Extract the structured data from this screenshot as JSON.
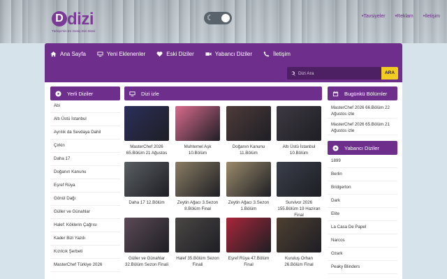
{
  "brand": {
    "logo_mark": "D",
    "logo_text": "dizi",
    "tagline": "Türkiye'nin En Geniş Dizi Sitesi"
  },
  "top_links": [
    "Tavsiyeler",
    "Reklam",
    "İletişim"
  ],
  "nav": [
    {
      "label": "Ana Sayfa",
      "icon": "home-icon"
    },
    {
      "label": "Yeni Eklenenler",
      "icon": "monitor-icon"
    },
    {
      "label": "Eski Diziler",
      "icon": "heart-icon"
    },
    {
      "label": "Yabancı Diziler",
      "icon": "video-icon"
    },
    {
      "label": "İletişim",
      "icon": "phone-icon"
    }
  ],
  "search": {
    "placeholder": "Dizi Ara",
    "button": "ARA"
  },
  "left_panel": {
    "title": "Yerli Diziler",
    "items": [
      "Abi",
      "Altı Üstü İstanbul",
      "Ayrılık da Sevdaya Dahil",
      "Çirkin",
      "Daha 17",
      "Doğanın Kanunu",
      "Eşref Rüya",
      "Gönül Dağı",
      "Güller ve Günahlar",
      "Halef: Köklerin Çağrısı",
      "Kader Bizi Yazdı",
      "Kızılcık Şerbeti",
      "MasterChef Türkiye 2026"
    ]
  },
  "center_panel": {
    "title": "Dizi izle",
    "cards": [
      {
        "title": "MasterChef 2026 65.Bölüm 21 Ağustos",
        "color": "#2b2f5a"
      },
      {
        "title": "Muhtemel Aşk 10.Bölüm",
        "color": "#d96a8c"
      },
      {
        "title": "Doğanın Kanunu 11.Bölüm",
        "color": "#4e3b3a"
      },
      {
        "title": "Altı Üstü İstanbul 10.Bölüm",
        "color": "#3d3942"
      },
      {
        "title": "Daha 17 12.Bölüm",
        "color": "#5a5f63"
      },
      {
        "title": "Zeytin Ağacı 3.Sezon 8.Bölüm Final",
        "color": "#8a7d63"
      },
      {
        "title": "Zeytin Ağacı 3.Sezon 1.Bölüm",
        "color": "#9a8b6b"
      },
      {
        "title": "Survivor 2026 155.Bölüm 19 Haziran Final",
        "color": "#3a3f4a"
      },
      {
        "title": "Güller ve Günahlar 32.Bölüm Sezon Finali",
        "color": "#5b4a57"
      },
      {
        "title": "Halef 35.Bölüm Sezon Finali",
        "color": "#4a4744"
      },
      {
        "title": "Eşref Rüya 47.Bölüm Final",
        "color": "#a8263a"
      },
      {
        "title": "Kuruluş Orhan 26.Bölüm Final",
        "color": "#4e4031"
      }
    ]
  },
  "right_panel_1": {
    "title": "Bugünkü Bölümler",
    "items": [
      "MasterChef 2026 66.Bölüm 22 Ağustos izle",
      "MasterChef 2026 65.Bölüm 21 Ağustos izle"
    ]
  },
  "right_panel_2": {
    "title": "Yabancı Diziler",
    "items": [
      "1899",
      "Berlin",
      "Bridgerton",
      "Dark",
      "Elite",
      "La Casa De Papel",
      "Narcos",
      "Ozark",
      "Peaky Blinders"
    ]
  },
  "colors": {
    "accent": "#6e2f8c",
    "search_button": "#f2cd21"
  }
}
